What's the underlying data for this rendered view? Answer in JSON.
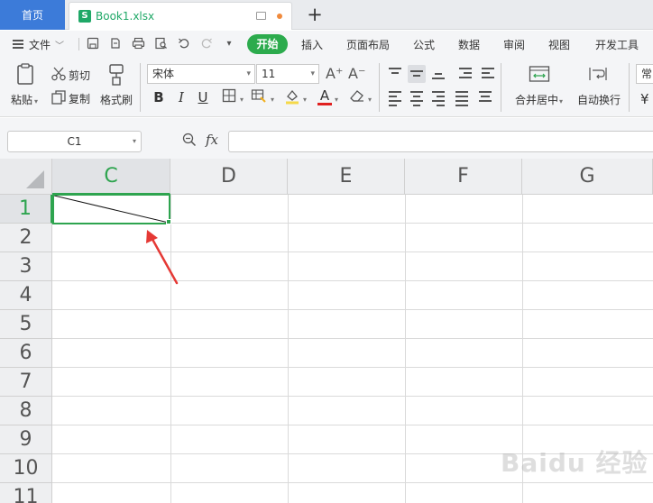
{
  "tabs": {
    "home_label": "首页",
    "doc_icon_letter": "S",
    "doc_name": "Book1.xlsx",
    "new_tab": "+"
  },
  "menu": {
    "file_label": "文件",
    "items": [
      "开始",
      "插入",
      "页面布局",
      "公式",
      "数据",
      "审阅",
      "视图",
      "开发工具"
    ],
    "active_index": 0
  },
  "ribbon": {
    "paste_label": "粘贴",
    "cut_label": "剪切",
    "copy_label": "复制",
    "format_painter_label": "格式刷",
    "font_name": "宋体",
    "font_size": "11",
    "grow_font": "A⁺",
    "shrink_font": "A⁻",
    "bold": "B",
    "italic": "I",
    "underline": "U",
    "font_color_letter": "A",
    "merge_label": "合并居中",
    "wrap_label": "自动换行",
    "number_format": "常"
  },
  "formula_bar": {
    "name_box": "C1",
    "fx": "fx",
    "formula": ""
  },
  "sheet": {
    "columns": [
      "C",
      "D",
      "E",
      "F",
      "G"
    ],
    "rows": [
      "1",
      "2",
      "3",
      "4",
      "5",
      "6",
      "7",
      "8",
      "9",
      "10",
      "11"
    ],
    "selected_cell": "C1",
    "selected_column": "C",
    "selected_row": "1"
  },
  "watermark": "Baidu 经验",
  "colors": {
    "accent_green": "#2ea44f",
    "home_tab_blue": "#3c7bd9",
    "arrow_red": "#e53935"
  }
}
